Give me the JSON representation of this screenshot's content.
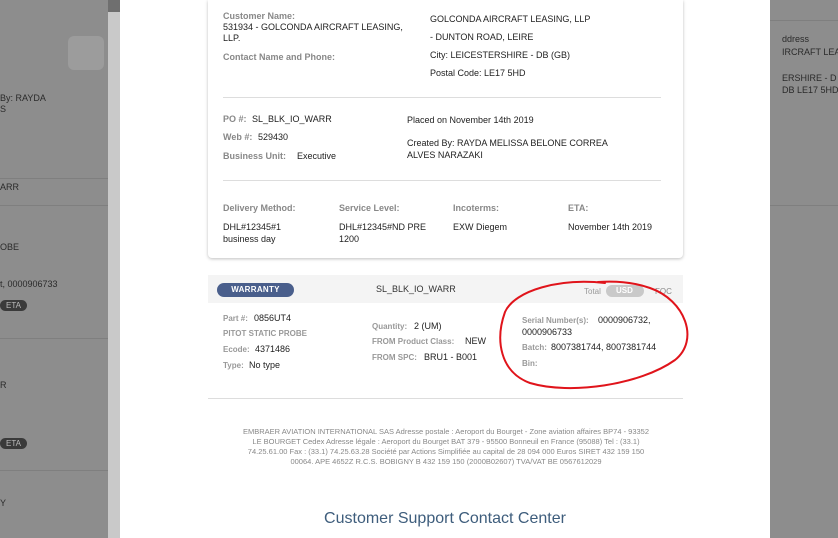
{
  "background": {
    "left_texts": [
      "By: RAYDA",
      "S",
      "ARR",
      "OBE",
      "t, 0000906733",
      "R",
      "Y"
    ],
    "left_pills": [
      "ETA",
      "ETA"
    ],
    "right_texts": [
      "ddress",
      "IRCRAFT LEASIN",
      "ERSHIRE - D",
      "DB LE17 5HD"
    ]
  },
  "customer": {
    "name_label": "Customer Name:",
    "name_value_1": "531934 - GOLCONDA AIRCRAFT LEASING,",
    "name_value_2": "LLP.",
    "contact_label": "Contact Name and Phone:"
  },
  "shipping": {
    "line1": "GOLCONDA AIRCRAFT LEASING, LLP",
    "line2": "- DUNTON ROAD, LEIRE",
    "line3": "City: LEICESTERSHIRE - DB (GB)",
    "line4": "Postal Code: LE17 5HD"
  },
  "order": {
    "po_label": "PO #:",
    "po_value": "SL_BLK_IO_WARR",
    "web_label": "Web #:",
    "web_value": "529430",
    "bu_label": "Business Unit:",
    "bu_value": "Executive",
    "placed": "Placed on November 14th 2019",
    "created_1": "Created By: RAYDA MELISSA BELONE CORREA",
    "created_2": "ALVES NARAZAKI"
  },
  "delivery": {
    "method_label": "Delivery Method:",
    "method_value_1": "DHL#12345#1",
    "method_value_2": "business day",
    "service_label": "Service Level:",
    "service_value_1": "DHL#12345#ND PRE",
    "service_value_2": "1200",
    "incoterms_label": "Incoterms:",
    "incoterms_value": "EXW Diegem",
    "eta_label": "ETA:",
    "eta_value": "November 14th 2019"
  },
  "warranty": {
    "badge": "WARRANTY",
    "code": "SL_BLK_IO_WARR",
    "total_label": "Total",
    "usd": "USD",
    "foc": "FOC",
    "part_label": "Part #:",
    "part_value": "0856UT4",
    "part_desc": "PITOT STATIC PROBE",
    "ecode_label": "Ecode:",
    "ecode_value": "4371486",
    "type_label": "Type:",
    "type_value": "No type",
    "qty_label": "Quantity:",
    "qty_value": "2 (UM)",
    "class_label": "FROM Product Class:",
    "class_value": "NEW",
    "spc_label": "FROM SPC:",
    "spc_value": "BRU1 - B001",
    "serial_label": "Serial Number(s):",
    "serial_value_1": "0000906732,",
    "serial_value_2": "0000906733",
    "batch_label": "Batch:",
    "batch_value": "8007381744, 8007381744",
    "bin_label": "Bin:"
  },
  "footer": {
    "legal_1": "EMBRAER AVIATION INTERNATIONAL SAS Adresse postale : Aeroport du Bourget - Zone aviation affaires BP74 - 93352",
    "legal_2": "LE BOURGET Cedex Adresse légale : Aeroport du Bourget BAT 379 - 95500 Bonneuil en France (95088) Tel : (33.1)",
    "legal_3": "74.25.61.00 Fax : (33.1) 74.25.63.28 Société par Actions Simplifiée au capital de 28 094 000 Euros SIRET 432 159 150",
    "legal_4": "00064. APE 4652Z R.C.S. BOBIGNY B 432 159 150 (2000B02607) TVA/VAT BE 0567612029",
    "support_title": "Customer Support Contact Center"
  },
  "colors": {
    "badge": "#4a5f8c",
    "annotation": "#e0141b",
    "support_title": "#3e5d7c"
  }
}
